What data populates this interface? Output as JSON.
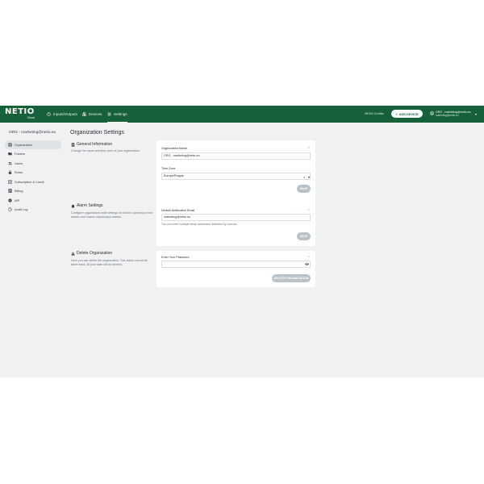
{
  "topbar": {
    "brand": "NETIO",
    "brand_sub": "Cloud",
    "nav": [
      {
        "label": "Inputs/Outputs",
        "icon": "clock-icon"
      },
      {
        "label": "Devices",
        "icon": "devices-icon"
      },
      {
        "label": "Settings",
        "icon": "settings-icon",
        "active": true
      }
    ],
    "credits": "49100 Credits",
    "add_device": "ADD DEVICE",
    "user_name": "ORG - marketing@netio.eu",
    "user_email": "marketing@netio.eu"
  },
  "sidebar": {
    "org": "ORG - marketing@netio.eu",
    "items": [
      {
        "label": "Organization",
        "icon": "organization-icon",
        "active": true
      },
      {
        "label": "Folders",
        "icon": "folders-icon"
      },
      {
        "label": "Users",
        "icon": "users-icon"
      },
      {
        "label": "Roles",
        "icon": "lock-icon"
      },
      {
        "label": "Subscription & Credit",
        "icon": "receipt-icon"
      },
      {
        "label": "Billing",
        "icon": "billing-icon"
      },
      {
        "label": "API",
        "icon": "api-icon"
      },
      {
        "label": "Audit Log",
        "icon": "audit-log-icon"
      }
    ]
  },
  "main": {
    "title": "Organization Settings",
    "general": {
      "title": "General Information",
      "desc": "Change the name and time zone of your organization.",
      "org_name_label": "Organization Name",
      "org_name_value": "ORG - marketing@netio.eu",
      "tz_label": "Time Zone",
      "tz_value": "Europe/Prague",
      "save": "SAVE"
    },
    "alarm": {
      "title": "Alarm Settings",
      "desc": "Configure organization-wide settings for device connection error alarms and custom input/output alarms.",
      "email_label": "Default Notification Email",
      "email_value": "marketing@netio.eu",
      "hint": "You can enter multiple email addresses delimited by comma.",
      "save": "SAVE"
    },
    "delete": {
      "title": "Delete Organization",
      "desc": "Here you can delete the organization. This action cannot be taken back. All your data will be deleted.",
      "password_label": "Enter Your Password",
      "button": "DELETE ORGANIZATION"
    },
    "required_mark": "*"
  }
}
